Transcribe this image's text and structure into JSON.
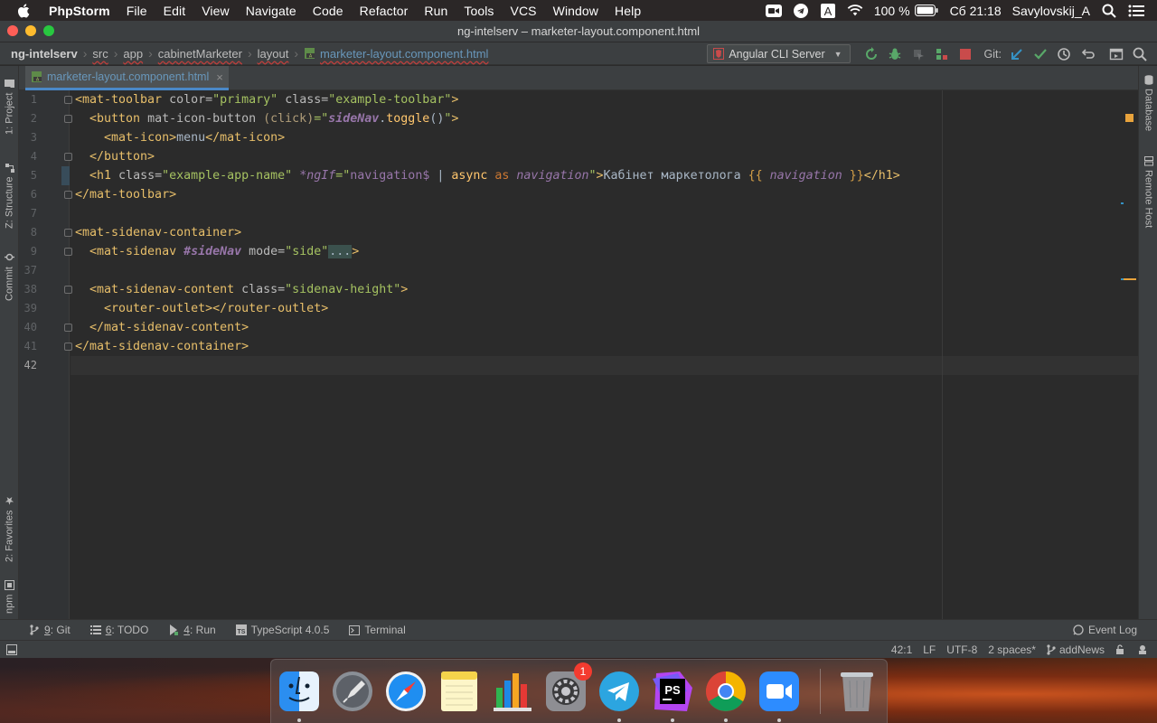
{
  "menubar": {
    "app_name": "PhpStorm",
    "items": [
      "File",
      "Edit",
      "View",
      "Navigate",
      "Code",
      "Refactor",
      "Run",
      "Tools",
      "VCS",
      "Window",
      "Help"
    ],
    "battery": "100 %",
    "clock": "Сб 21:18",
    "user": "Savylovskij_A",
    "input_source": "A"
  },
  "window": {
    "title": "ng-intelserv – marketer-layout.component.html"
  },
  "breadcrumbs": {
    "project": "ng-intelserv",
    "items": [
      "src",
      "app",
      "cabinetMarketer",
      "layout"
    ],
    "file": "marketer-layout.component.html"
  },
  "toolbar": {
    "run_config": "Angular CLI Server",
    "git_label": "Git:"
  },
  "editor_tab": {
    "label": "marketer-layout.component.html",
    "close": "×"
  },
  "left_tools": {
    "project": "1: Project",
    "structure": "Z: Structure",
    "commit": "Commit",
    "favorites": "2: Favorites",
    "npm": "npm"
  },
  "right_tools": {
    "database": "Database",
    "remote_host": "Remote Host"
  },
  "code": {
    "line_numbers": [
      "1",
      "2",
      "3",
      "4",
      "5",
      "6",
      "7",
      "8",
      "9",
      "37",
      "38",
      "39",
      "40",
      "41",
      "42"
    ],
    "l1": {
      "open": "<mat-toolbar",
      "a1": " color=",
      "v1": "\"primary\"",
      "a2": " class=",
      "v2": "\"example-toolbar\"",
      "close": ">"
    },
    "l2": {
      "open": "<button",
      "a1": " mat-icon-button ",
      "ev": "(click)",
      "eq": "=\"",
      "obj": "sideNav",
      "dot": ".",
      "fn": "toggle",
      "paren": "()",
      "q": "\"",
      "close": ">"
    },
    "l3": {
      "open": "<mat-icon>",
      "text": "menu",
      "close": "</mat-icon>"
    },
    "l4": {
      "close": "</button>"
    },
    "l5": {
      "open": "<h1",
      "a1": " class=",
      "v1": "\"example-app-name\"",
      "sp": " ",
      "ngif": "*ngIf",
      "eq": "=\"",
      "var": "navigation$",
      "pipe": " | ",
      "async": "async",
      "as": " as ",
      "alias": "navigation",
      "q": "\"",
      "gt": ">",
      "text": "Кабінет маркетолога ",
      "ob": "{{",
      "interp": " navigation ",
      "cb": "}}",
      "close": "</h1>"
    },
    "l6": {
      "close": "</mat-toolbar>"
    },
    "l8": {
      "open": "<mat-sidenav-container>"
    },
    "l9": {
      "open": "<mat-sidenav",
      "sp": " ",
      "ref": "#sideNav",
      "a1": " mode=",
      "v1": "\"side\"",
      "fold": "...",
      "close": ">"
    },
    "l38": {
      "open": "<mat-sidenav-content",
      "a1": " class=",
      "v1": "\"sidenav-height\"",
      "close": ">"
    },
    "l39": {
      "open": "<router-outlet></router-outlet>"
    },
    "l40": {
      "close": "</mat-sidenav-content>"
    },
    "l41": {
      "close": "</mat-sidenav-container>"
    }
  },
  "bottom_tools": {
    "git": {
      "num": "9",
      "label": ": Git"
    },
    "todo": {
      "num": "6",
      "label": ": TODO"
    },
    "run": {
      "num": "4",
      "label": ": Run"
    },
    "typescript": "TypeScript 4.0.5",
    "terminal": "Terminal",
    "event_log": "Event Log"
  },
  "status": {
    "position": "42:1",
    "line_sep": "LF",
    "encoding": "UTF-8",
    "indent": "2 spaces*",
    "branch": "addNews"
  },
  "dock": {
    "apps": [
      "finder-icon",
      "launchpad-icon",
      "safari-icon",
      "notes-icon",
      "numbers-icon",
      "system-preferences-icon",
      "telegram-icon",
      "phpstorm-icon",
      "chrome-icon",
      "zoom-icon",
      "trash-icon"
    ],
    "sysprefs_badge": "1",
    "phpstorm_label": "PS"
  },
  "colors": {
    "tag": "#e8bf6a",
    "string": "#a5c261",
    "keyword": "#cc7832",
    "angular": "#9876aa"
  }
}
